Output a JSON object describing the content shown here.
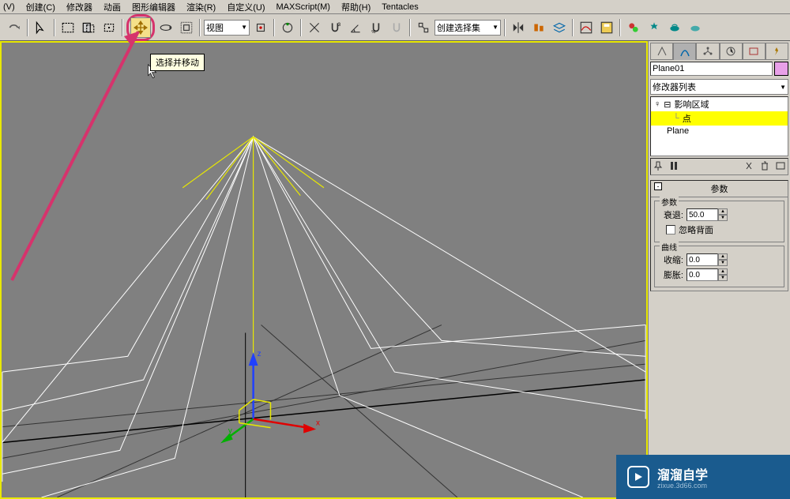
{
  "menu": {
    "view": "(V)",
    "create": "创建(C)",
    "modifier": "修改器",
    "anim": "动画",
    "grapheditor": "图形编辑器",
    "render": "渲染(R)",
    "customize": "自定义(U)",
    "maxscript": "MAXScript(M)",
    "help": "帮助(H)",
    "tentacles": "Tentacles"
  },
  "toolbar": {
    "view_dd": "视图",
    "selset_dd": "创建选择集",
    "tooltip": "选择并移动"
  },
  "rightpanel": {
    "object_name": "Plane01",
    "modlist_label": "修改器列表",
    "stack": {
      "modifier": "影响区域",
      "sub": "点",
      "base": "Plane"
    },
    "rollout_title": "参数",
    "group_params": "参数",
    "falloff_label": "衰退:",
    "falloff_value": "50.0",
    "ignore_back_label": "忽略背面",
    "group_curve": "曲线",
    "pinch_label": "收缩:",
    "pinch_value": "0.0",
    "bubble_label": "膨胀:",
    "bubble_value": "0.0"
  },
  "watermark": {
    "title": "溜溜自学",
    "url": "zixue.3d66.com"
  },
  "axis": {
    "x": "x",
    "y": "y",
    "z": "z"
  }
}
